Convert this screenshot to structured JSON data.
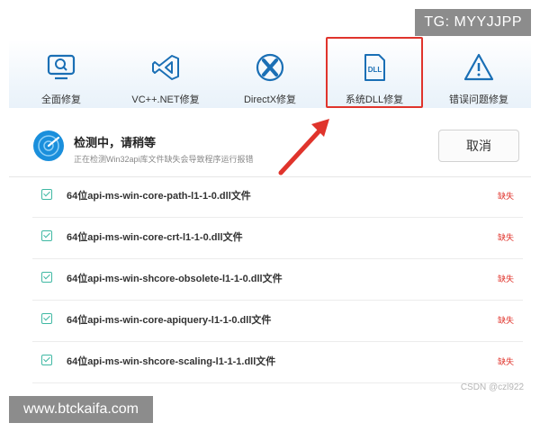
{
  "watermark_top": "TG: MYYJJPP",
  "watermark_bottom": "www.btckaifa.com",
  "watermark_csdn": "CSDN @czl922",
  "toolbar": {
    "items": [
      {
        "label": "全面修复",
        "icon": "monitor-search-icon"
      },
      {
        "label": "VC++.NET修复",
        "icon": "visual-studio-icon"
      },
      {
        "label": "DirectX修复",
        "icon": "directx-icon"
      },
      {
        "label": "系统DLL修复",
        "icon": "dll-file-icon",
        "icon_text": "DLL",
        "active": true
      },
      {
        "label": "错误问题修复",
        "icon": "warning-icon"
      }
    ],
    "highlight_color": "#e0342c"
  },
  "status": {
    "title": "检测中，请稍等",
    "subtitle": "正在检测Win32api库文件缺失会导致程序运行报错",
    "cancel_label": "取消"
  },
  "files": [
    {
      "name": "64位api-ms-win-core-path-l1-1-0.dll文件",
      "status": "缺失"
    },
    {
      "name": "64位api-ms-win-core-crt-l1-1-0.dll文件",
      "status": "缺失"
    },
    {
      "name": "64位api-ms-win-shcore-obsolete-l1-1-0.dll文件",
      "status": "缺失"
    },
    {
      "name": "64位api-ms-win-core-apiquery-l1-1-0.dll文件",
      "status": "缺失"
    },
    {
      "name": "64位api-ms-win-shcore-scaling-l1-1-1.dll文件",
      "status": "缺失"
    }
  ],
  "colors": {
    "accent": "#1a8fdc",
    "check": "#3fb8a3",
    "missing": "#e0342c"
  }
}
